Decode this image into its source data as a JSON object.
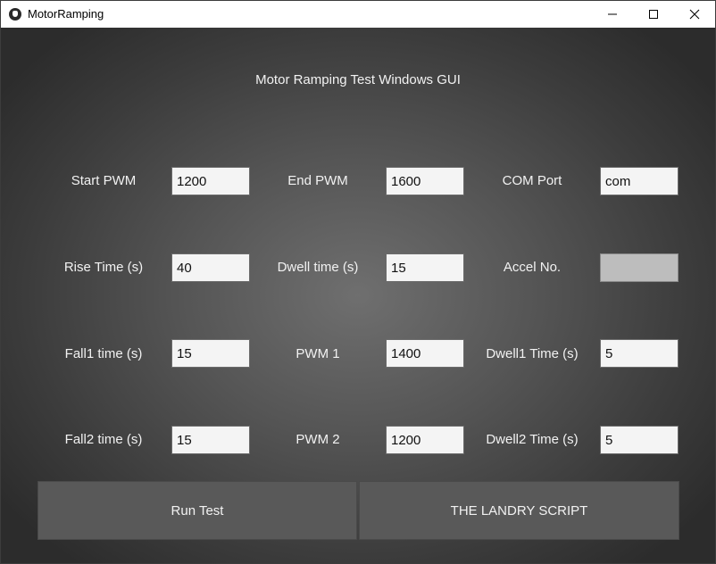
{
  "window": {
    "title": "MotorRamping"
  },
  "main": {
    "heading": "Motor Ramping Test Windows GUI",
    "rows": [
      [
        {
          "label": "Start PWM",
          "value": "1200"
        },
        {
          "label": "End PWM",
          "value": "1600"
        },
        {
          "label": "COM Port",
          "value": "com"
        }
      ],
      [
        {
          "label": "Rise Time (s)",
          "value": "40"
        },
        {
          "label": "Dwell time (s)",
          "value": "15"
        },
        {
          "label": "Accel No.",
          "value": ""
        }
      ],
      [
        {
          "label": "Fall1 time (s)",
          "value": "15"
        },
        {
          "label": "PWM 1",
          "value": "1400"
        },
        {
          "label": "Dwell1 Time (s)",
          "value": "5"
        }
      ],
      [
        {
          "label": "Fall2 time (s)",
          "value": "15"
        },
        {
          "label": "PWM 2",
          "value": "1200"
        },
        {
          "label": "Dwell2 Time (s)",
          "value": "5"
        }
      ]
    ],
    "buttons": {
      "run_label": "Run Test",
      "script_label": "THE LANDRY SCRIPT"
    }
  },
  "colors": {
    "background_center": "#6f6f6f",
    "background_edge": "#2c2c2c",
    "field_background": "#f4f4f4",
    "disabled_field": "#bdbdbd",
    "button": "#595959"
  }
}
